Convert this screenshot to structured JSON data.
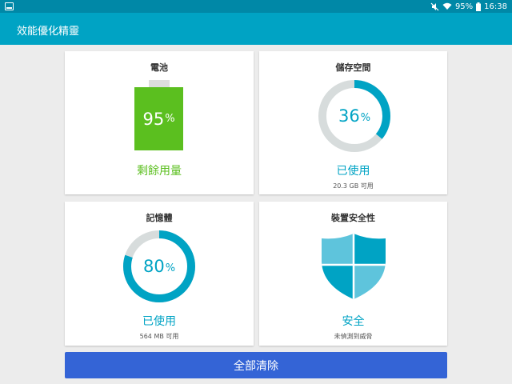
{
  "status_bar": {
    "battery_text": "95%",
    "time": "16:38",
    "icons": [
      "screenshot-icon",
      "mute-icon",
      "wifi-icon",
      "battery-icon"
    ]
  },
  "app_bar": {
    "title": "效能優化精靈"
  },
  "battery": {
    "title": "電池",
    "value": "95",
    "unit": "%",
    "level": 0.95,
    "status": "剩餘用量",
    "color": "#5bbf1f"
  },
  "storage": {
    "title": "儲存空間",
    "value": "36",
    "unit": "%",
    "fraction": 0.36,
    "status": "已使用",
    "sub": "20.3 GB 可用"
  },
  "memory": {
    "title": "記憶體",
    "value": "80",
    "unit": "%",
    "fraction": 0.8,
    "status": "已使用",
    "sub": "564 MB 可用"
  },
  "security": {
    "title": "裝置安全性",
    "status": "安全",
    "sub": "未偵測到威脅",
    "icon": "shield-icon"
  },
  "actions": {
    "clear_all": "全部清除"
  },
  "colors": {
    "accent": "#00a3c4",
    "status_bar": "#0088a7",
    "battery_green": "#5bbf1f",
    "ring_track": "#d7dcdc",
    "button": "#3464d6"
  }
}
